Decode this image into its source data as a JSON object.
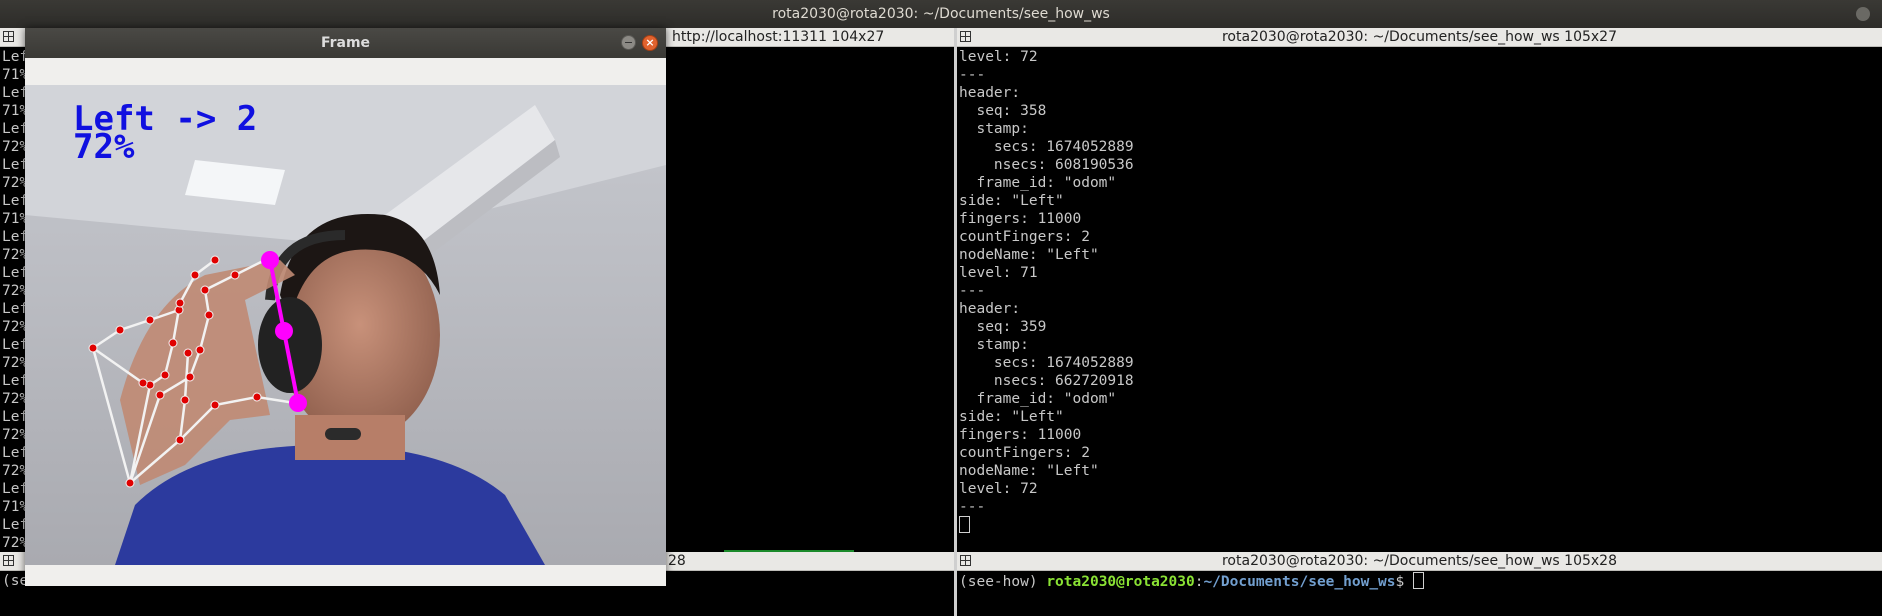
{
  "topbar": {
    "title": "rota2030@rota2030: ~/Documents/see_how_ws"
  },
  "pane_tl": {
    "lines": [
      "Lef",
      "71%",
      "Lef",
      "71%",
      "Lef",
      "72%",
      "Lef",
      "72%",
      "Lef",
      "71%",
      "Lef",
      "72%",
      "Lef",
      "72%",
      "Lef",
      "72%",
      "Lef",
      "72%",
      "Lef",
      "72%",
      "Lef",
      "72%",
      "Lef",
      "72%",
      "Lef",
      "71%",
      "Lef",
      "72%"
    ]
  },
  "pane_tm": {
    "title": "http://localhost:11311 104x27"
  },
  "pane_tr": {
    "title": "rota2030@rota2030: ~/Documents/see_how_ws 105x27",
    "lines": [
      "level: 72",
      "---",
      "header:",
      "  seq: 358",
      "  stamp:",
      "    secs: 1674052889",
      "    nsecs: 608190536",
      "  frame_id: \"odom\"",
      "side: \"Left\"",
      "fingers: 11000",
      "countFingers: 2",
      "nodeName: \"Left\"",
      "level: 71",
      "---",
      "header:",
      "  seq: 359",
      "  stamp:",
      "    secs: 1674052889",
      "    nsecs: 662720918",
      "  frame_id: \"odom\"",
      "side: \"Left\"",
      "fingers: 11000",
      "countFingers: 2",
      "nodeName: \"Left\"",
      "level: 72",
      "---"
    ]
  },
  "pane_bl": {
    "text": "(se",
    "title_fragment": "28"
  },
  "pane_br": {
    "title": "rota2030@rota2030: ~/Documents/see_how_ws 105x28",
    "prompt_env": "(see-how) ",
    "prompt_user": "rota2030@rota2030",
    "prompt_sep": ":",
    "prompt_path": "~/Documents/see_how_ws",
    "prompt_end": "$ "
  },
  "frame_window": {
    "title": "Frame",
    "close_glyph": "×",
    "overlay_line1": "Left -> 2",
    "overlay_line2": "72%"
  },
  "colors": {
    "landmark": "#e00000",
    "skeleton": "#f0f0f0",
    "pinch": "#ff00ff",
    "overlay_text": "#1010e0"
  }
}
